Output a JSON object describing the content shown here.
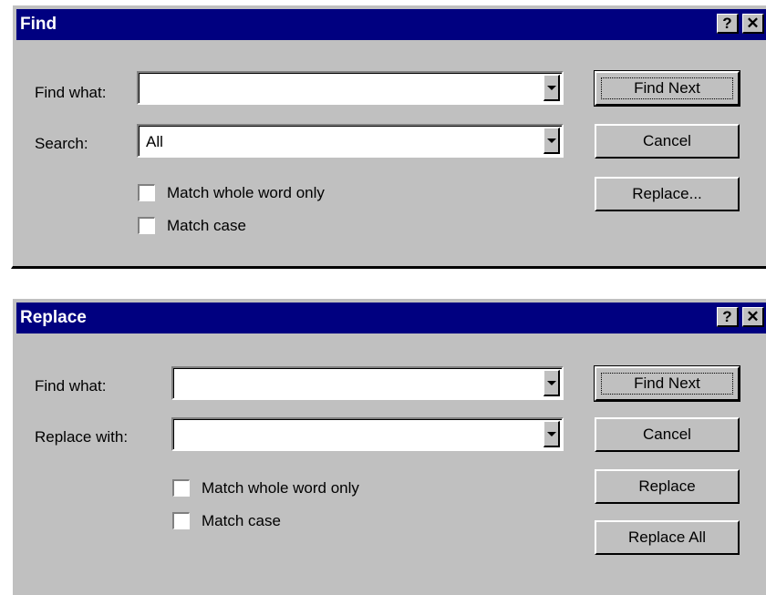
{
  "find_dialog": {
    "title": "Find",
    "help_symbol": "?",
    "close_symbol": "✕",
    "find_what_label": "Find what:",
    "find_what_value": "",
    "search_label": "Search:",
    "search_value": "All",
    "match_whole_word_label": "Match whole word only",
    "match_case_label": "Match case",
    "find_next_label": "Find Next",
    "cancel_label": "Cancel",
    "replace_label": "Replace..."
  },
  "replace_dialog": {
    "title": "Replace",
    "help_symbol": "?",
    "close_symbol": "✕",
    "find_what_label": "Find what:",
    "find_what_value": "",
    "replace_with_label": "Replace with:",
    "replace_with_value": "",
    "match_whole_word_label": "Match whole word only",
    "match_case_label": "Match case",
    "find_next_label": "Find Next",
    "cancel_label": "Cancel",
    "replace_label": "Replace",
    "replace_all_label": "Replace All"
  },
  "icons": [
    "help-icon",
    "close-icon",
    "dropdown-arrow-icon"
  ],
  "colors": {
    "titlebar": "#000080",
    "dialog_bg": "#c0c0c0"
  }
}
